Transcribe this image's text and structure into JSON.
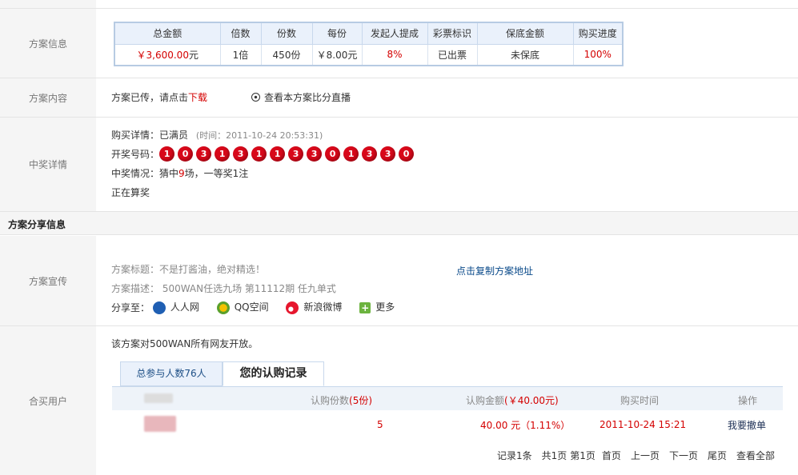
{
  "plan_info": {
    "label": "方案信息",
    "headers": [
      "总金额",
      "倍数",
      "份数",
      "每份",
      "发起人提成",
      "彩票标识",
      "保底金额",
      "购买进度"
    ],
    "values": {
      "total_amount": "￥3,600.00",
      "total_unit": "元",
      "multiple": "1倍",
      "shares": "450份",
      "per_share": "￥8.00元",
      "commission": "8%",
      "ticket_status": "已出票",
      "guarantee": "未保底",
      "progress": "100%"
    }
  },
  "plan_content": {
    "label": "方案内容",
    "text": "方案已传，请点击",
    "download": "下载",
    "live_link": "查看本方案比分直播"
  },
  "win_details": {
    "label": "中奖详情",
    "purchase_label": "购买详情：",
    "purchase_status": "已满员",
    "time_text": "(时间：2011-10-24 20:53:31)",
    "numbers_label": "开奖号码：",
    "numbers": [
      "1",
      "0",
      "3",
      "1",
      "3",
      "1",
      "1",
      "3",
      "3",
      "0",
      "1",
      "3",
      "3",
      "0"
    ],
    "result_label": "中奖情况：",
    "result_prefix": "猜中",
    "result_count": "9",
    "result_suffix": "场，一等奖1注",
    "calc_status": "正在算奖"
  },
  "share_section": {
    "title": "方案分享信息"
  },
  "promo": {
    "label": "方案宣传",
    "title_line": "方案标题：不是打酱油，绝对精选！",
    "desc_line": "方案描述： 500WAN任选九场 第11112期 任九单式",
    "copy_link": "点击复制方案地址",
    "share_label": "分享至：",
    "share_targets": [
      "人人网",
      "QQ空间",
      "新浪微博",
      "更多"
    ]
  },
  "buyers": {
    "label": "合买用户",
    "open_text": "该方案对500WAN所有网友开放。",
    "tab_participants": "总参与人数76人",
    "tab_records": "您的认购记录",
    "col_shares": "认购份数",
    "col_shares_val": "(5份)",
    "col_amount": "认购金额",
    "col_amount_val": "(￥40.00元)",
    "col_time": "购买时间",
    "col_op": "操作",
    "row": {
      "shares": "5",
      "amount": "40.00 元（1.11%）",
      "time": "2011-10-24 15:21",
      "action": "我要撤单"
    },
    "pager": [
      "记录1条",
      "共1页",
      "第1页",
      "首页",
      "上一页",
      "下一页",
      "尾页",
      "查看全部"
    ]
  },
  "colors": {
    "accent_red": "#d40000",
    "link_blue": "#0a4a8a",
    "table_border": "#b7cbe3"
  }
}
